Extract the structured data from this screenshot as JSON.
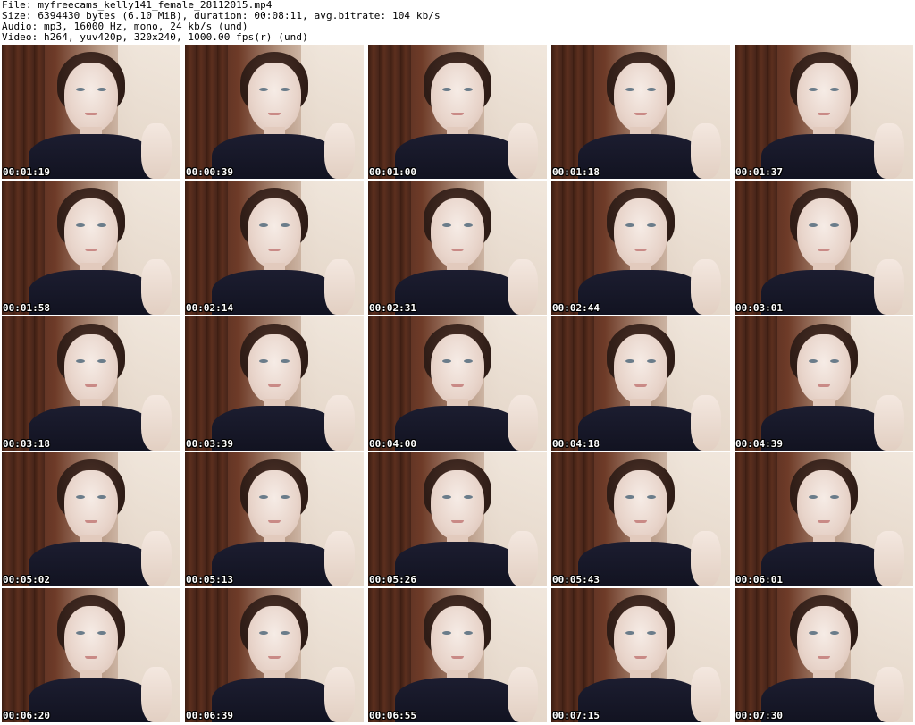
{
  "info": {
    "file": "File: myfreecams_kelly141_female_28112015.mp4",
    "size": "Size: 6394430 bytes (6.10 MiB), duration: 00:08:11, avg.bitrate: 104 kb/s",
    "audio": "Audio: mp3, 16000 Hz, mono, 24 kb/s (und)",
    "video": "Video: h264, yuv420p, 320x240, 1000.00 fps(r) (und)"
  },
  "thumbnails": [
    {
      "time": "00:01:19"
    },
    {
      "time": "00:00:39"
    },
    {
      "time": "00:01:00"
    },
    {
      "time": "00:01:18"
    },
    {
      "time": "00:01:37"
    },
    {
      "time": "00:01:58"
    },
    {
      "time": "00:02:14"
    },
    {
      "time": "00:02:31"
    },
    {
      "time": "00:02:44"
    },
    {
      "time": "00:03:01"
    },
    {
      "time": "00:03:18"
    },
    {
      "time": "00:03:39"
    },
    {
      "time": "00:04:00"
    },
    {
      "time": "00:04:18"
    },
    {
      "time": "00:04:39"
    },
    {
      "time": "00:05:02"
    },
    {
      "time": "00:05:13"
    },
    {
      "time": "00:05:26"
    },
    {
      "time": "00:05:43"
    },
    {
      "time": "00:06:01"
    },
    {
      "time": "00:06:20"
    },
    {
      "time": "00:06:39"
    },
    {
      "time": "00:06:55"
    },
    {
      "time": "00:07:15"
    },
    {
      "time": "00:07:30"
    }
  ]
}
